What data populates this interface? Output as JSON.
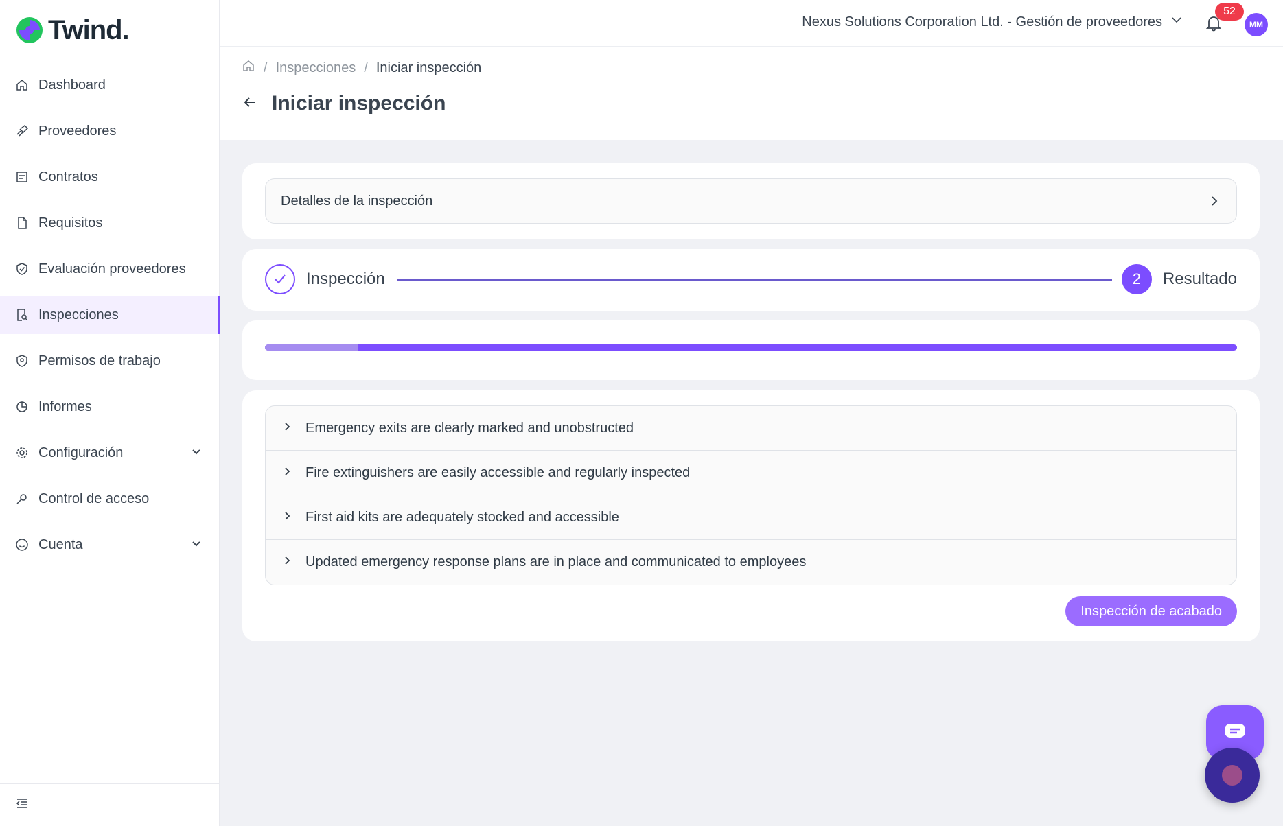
{
  "brand": {
    "name": "Twind.",
    "accent": "#7c4dff"
  },
  "sidebar": {
    "items": [
      {
        "label": "Dashboard",
        "icon": "home-icon"
      },
      {
        "label": "Proveedores",
        "icon": "handshake-icon"
      },
      {
        "label": "Contratos",
        "icon": "contract-icon"
      },
      {
        "label": "Requisitos",
        "icon": "file-icon"
      },
      {
        "label": "Evaluación proveedores",
        "icon": "shield-check-icon"
      },
      {
        "label": "Inspecciones",
        "icon": "inspection-icon",
        "active": true
      },
      {
        "label": "Permisos de trabajo",
        "icon": "shield-permit-icon"
      },
      {
        "label": "Informes",
        "icon": "pie-chart-icon"
      },
      {
        "label": "Configuración",
        "icon": "gear-icon",
        "expandable": true
      },
      {
        "label": "Control de acceso",
        "icon": "key-icon"
      },
      {
        "label": "Cuenta",
        "icon": "smile-icon",
        "expandable": true
      }
    ]
  },
  "header": {
    "organization": "Nexus Solutions Corporation Ltd. - Gestión de proveedores",
    "notifications_count": "52",
    "avatar_initials": "MM"
  },
  "breadcrumb": {
    "items": [
      "Inspecciones",
      "Iniciar inspección"
    ]
  },
  "page": {
    "title": "Iniciar inspección"
  },
  "details": {
    "label": "Detalles de la inspección"
  },
  "stepper": {
    "step1_label": "Inspección",
    "step2_number": "2",
    "step2_label": "Resultado"
  },
  "progress": {
    "fraction": 0.095
  },
  "checklist": {
    "items": [
      "Emergency exits are clearly marked and unobstructed",
      "Fire extinguishers are easily accessible and regularly inspected",
      "First aid kits are adequately stocked and accessible",
      "Updated emergency response plans are in place and communicated to employees"
    ]
  },
  "actions": {
    "finish_label": "Inspección de acabado"
  }
}
